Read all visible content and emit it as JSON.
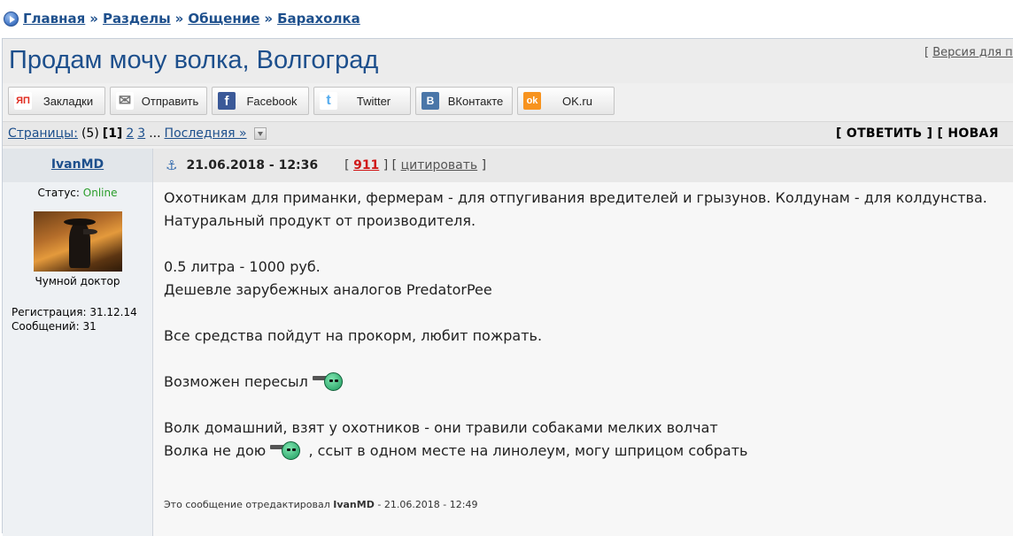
{
  "breadcrumb": {
    "items": [
      "Главная",
      "Разделы",
      "Общение",
      "Барахолка"
    ],
    "separator": "»"
  },
  "topic": {
    "title": "Продам мочу волка, Волгоград",
    "version_bracket_open": "[",
    "version_link": "Версия для п"
  },
  "share": {
    "buttons": [
      {
        "label": "Закладки",
        "icon": "yandex-bookmarks-icon",
        "icon_text": "ЯП",
        "color": "#e02b1f"
      },
      {
        "label": "Отправить",
        "icon": "envelope-icon",
        "icon_text": "✉",
        "color": "#777777"
      },
      {
        "label": "Facebook",
        "icon": "facebook-icon",
        "icon_text": "f",
        "color": "#3b5998"
      },
      {
        "label": "Twitter",
        "icon": "twitter-icon",
        "icon_text": "t",
        "color": "#55acee"
      },
      {
        "label": "ВКонтакте",
        "icon": "vk-icon",
        "icon_text": "B",
        "color": "#4a76a8"
      },
      {
        "label": "OK.ru",
        "icon": "odnoklassniki-icon",
        "icon_text": "ok",
        "color": "#f7931e"
      }
    ]
  },
  "pagination": {
    "label": "Страницы:",
    "total": "(5)",
    "current": "[1]",
    "pages": [
      "2",
      "3"
    ],
    "ellipsis": "...",
    "last": "Последняя »",
    "reply_buttons": "[ ОТВЕТИТЬ ] [ НОВАЯ"
  },
  "post": {
    "author": "IvanMD",
    "date": "21.06.2018 - 12:36",
    "number_open": "[",
    "number": "911",
    "mid_sep": "] [",
    "cite_label": "цитировать",
    "number_close": "]",
    "status_label": "Статус:",
    "status_value": "Online",
    "rank": "Чумной доктор",
    "registered": "Регистрация: 31.12.14",
    "messages": "Сообщений: 31",
    "body": {
      "line1": "Охотникам для приманки, фермерам - для отпугивания вредителей и грызунов. Колдунам - для колдунства.",
      "line2": "Натуральный продукт от производителя.",
      "line3": "0.5 литра - 1000 руб.",
      "line4": "Дешевле зарубежных аналогов PredatorPee",
      "line5": "Все средства пойдут на прокорм, любит пожрать.",
      "line6": "Возможен пересыл",
      "line7": "Волк домашний, взят у охотников - они травили собаками мелких волчат",
      "line8_a": "Волка не дою",
      "line8_b": ", ссыт в одном месте на линолеум, могу шприцом собрать"
    },
    "edit_prefix": "Это сообщение отредактировал",
    "edit_author": "IvanMD",
    "edit_suffix": "- 21.06.2018 - 12:49"
  }
}
